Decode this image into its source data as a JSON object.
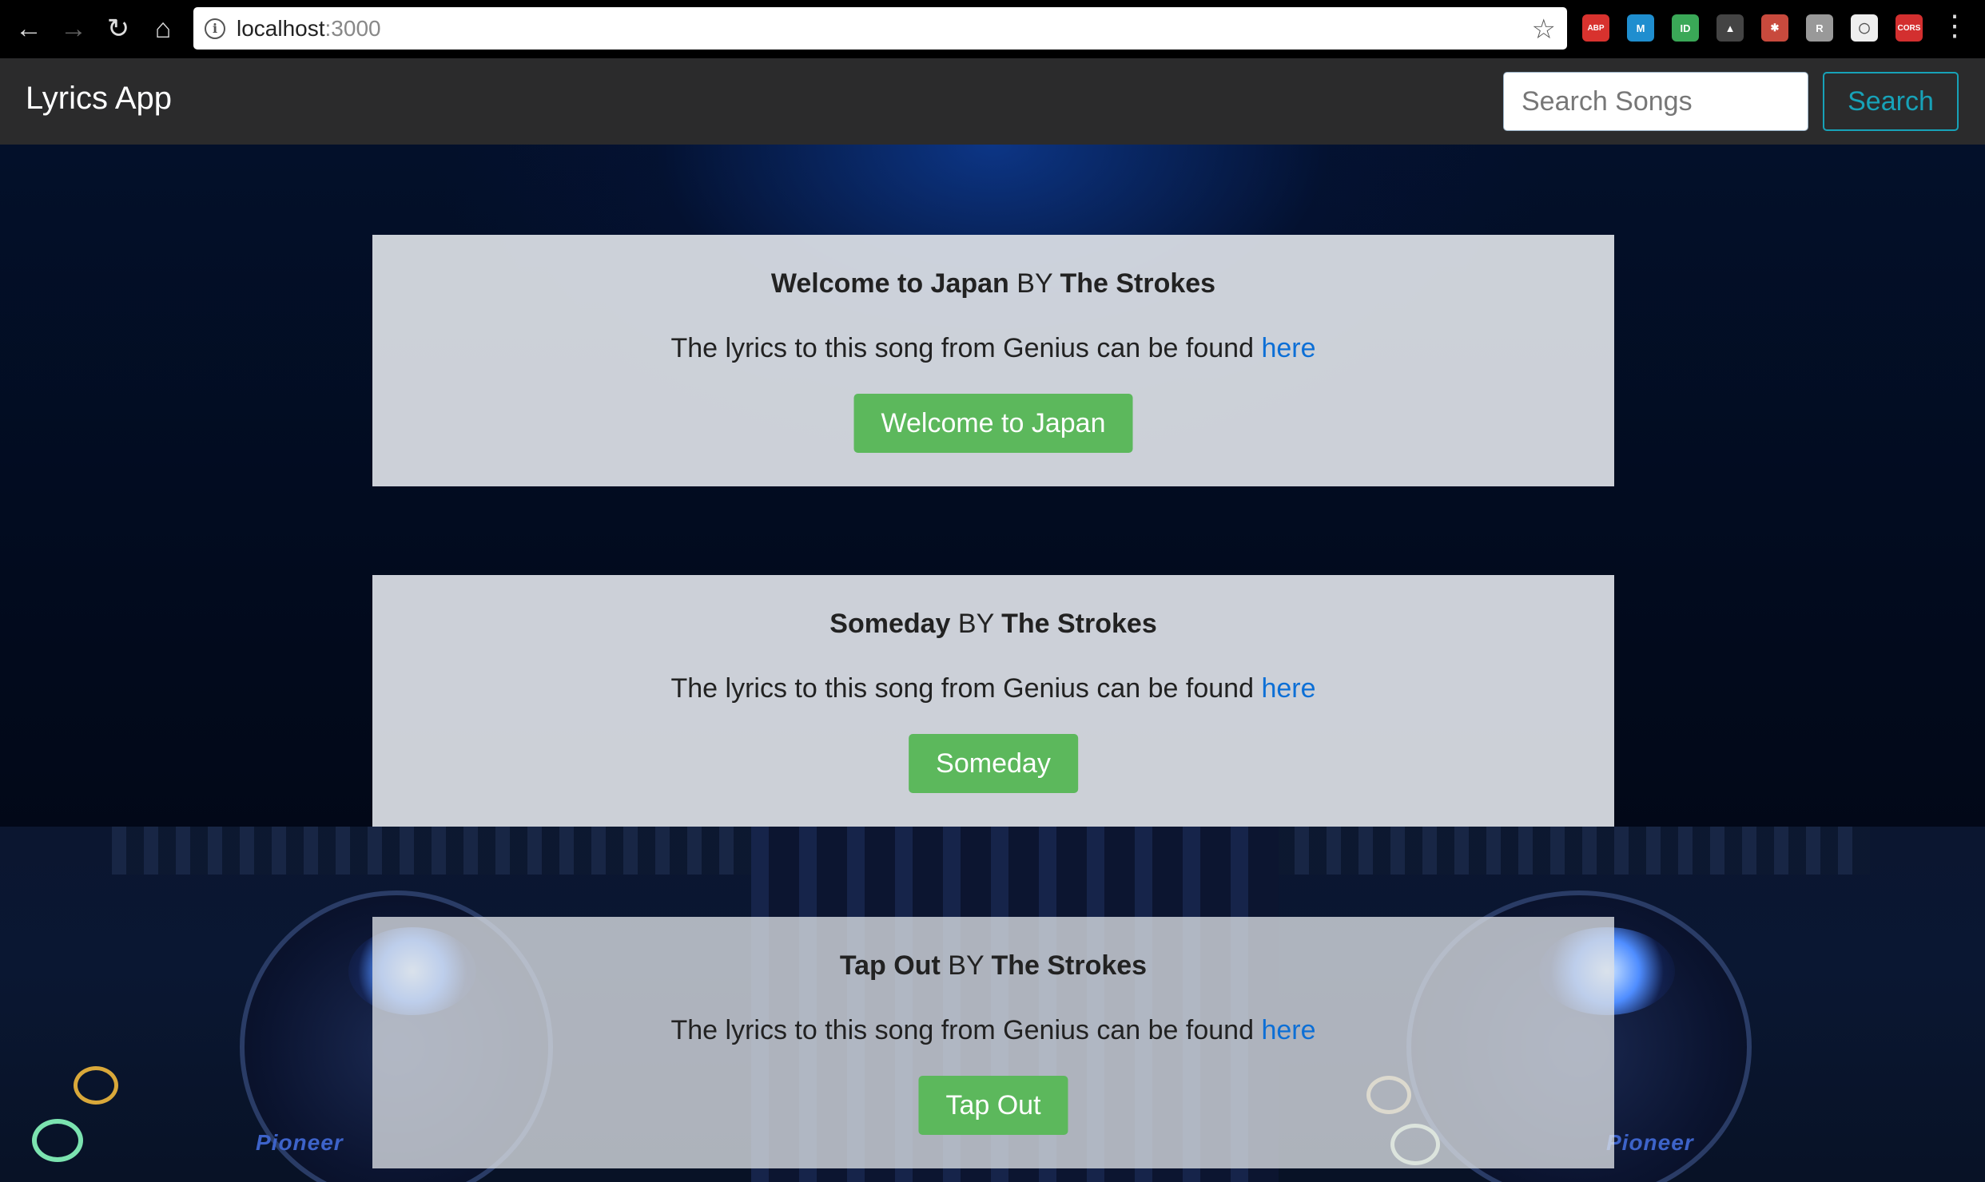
{
  "browser": {
    "url_host": "localhost",
    "url_port": ":3000",
    "extensions": [
      {
        "name": "adblock-plus-icon",
        "label": "ABP",
        "color": "#d8322e"
      },
      {
        "name": "m-extension-icon",
        "label": "M",
        "color": "#1f8ecf"
      },
      {
        "name": "id-extension-icon",
        "label": "ID",
        "color": "#3aa857"
      },
      {
        "name": "drive-icon",
        "label": "▲",
        "color": "#444"
      },
      {
        "name": "puzzle-extension-icon",
        "label": "✱",
        "color": "#c84a3d"
      },
      {
        "name": "gray-extension-icon",
        "label": "R",
        "color": "#999"
      },
      {
        "name": "circle-extension-icon",
        "label": "◯",
        "color": "#eee"
      },
      {
        "name": "cors-icon",
        "label": "CORS",
        "color": "#d32f2f"
      }
    ]
  },
  "navbar": {
    "brand": "Lyrics App",
    "search_placeholder": "Search Songs",
    "search_button": "Search"
  },
  "songs": [
    {
      "title": "Welcome to Japan",
      "by": "BY",
      "artist": "The Strokes",
      "text": "The lyrics to this song from Genius can be found",
      "link": "here",
      "button": "Welcome to Japan"
    },
    {
      "title": "Someday",
      "by": "BY",
      "artist": "The Strokes",
      "text": "The lyrics to this song from Genius can be found",
      "link": "here",
      "button": "Someday"
    },
    {
      "title": "Tap Out",
      "by": "BY",
      "artist": "The Strokes",
      "text": "The lyrics to this song from Genius can be found",
      "link": "here",
      "button": "Tap Out"
    }
  ],
  "background": {
    "brand_marks": [
      "Pioneer",
      "Pioneer"
    ]
  },
  "colors": {
    "navbar_bg": "#2b2b2c",
    "search_accent": "#17a2b8",
    "song_button": "#5cb85c",
    "link": "#0c6fd6"
  }
}
